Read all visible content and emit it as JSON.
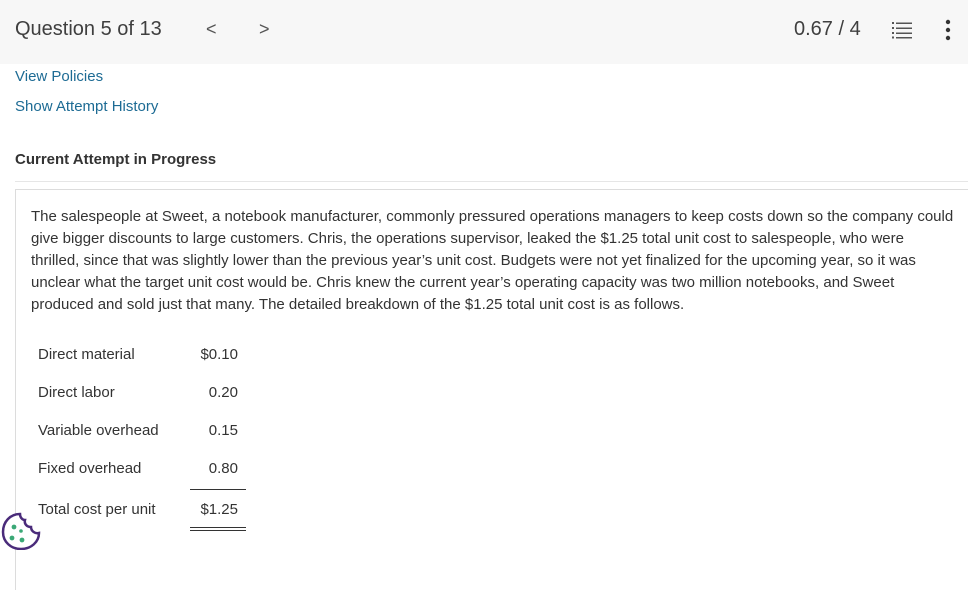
{
  "header": {
    "question_counter": "Question 5 of 13",
    "prev_glyph": "<",
    "next_glyph": ">",
    "score": "0.67 / 4",
    "list_icon": "list-icon",
    "more_icon": "more-vertical-icon"
  },
  "links": {
    "view_policies": "View Policies",
    "show_attempt_history": "Show Attempt History"
  },
  "attempt": {
    "heading": "Current Attempt in Progress"
  },
  "question": {
    "text": "The salespeople at Sweet, a notebook manufacturer, commonly pressured operations managers to keep costs down so the company could give bigger discounts to large customers. Chris, the operations supervisor, leaked the $1.25 total unit cost to salespeople, who were thrilled, since that was slightly lower than the previous year’s unit cost. Budgets were not yet finalized for the upcoming year, so it was unclear what the target unit cost would be. Chris knew the current year’s operating capacity was two million notebooks, and Sweet produced and sold just that many. The detailed breakdown of the $1.25 total unit cost is as follows."
  },
  "cost_table": [
    {
      "label": "Direct material",
      "value": "$0.10"
    },
    {
      "label": "Direct labor",
      "value": "0.20"
    },
    {
      "label": "Variable overhead",
      "value": "0.15"
    },
    {
      "label": "Fixed overhead",
      "value": "0.80"
    },
    {
      "label": "Total cost per unit",
      "value": "$1.25"
    }
  ],
  "colors": {
    "link": "#1d6b94",
    "topbar": "#f7f7f7",
    "text": "#333333"
  },
  "widgets": {
    "cookie_icon": "cookie-icon"
  }
}
